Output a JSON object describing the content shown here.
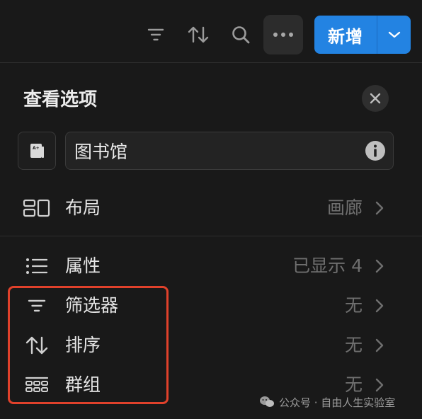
{
  "toolbar": {
    "icons": [
      "filter-icon",
      "sort-icon",
      "search-icon",
      "more-icon"
    ],
    "new_button_label": "新增",
    "new_button_dropdown_icon": "chevron-down-icon",
    "accent_color": "#2383e2"
  },
  "panel": {
    "title": "查看选项",
    "close_icon": "close-icon",
    "database": {
      "icon": "book-icon",
      "name": "图书馆",
      "info_icon": "info-icon"
    },
    "layout": {
      "label": "布局",
      "value": "画廊",
      "icon": "layout-icon"
    },
    "properties": {
      "label": "属性",
      "value": "已显示 4",
      "icon": "list-icon"
    },
    "filter": {
      "label": "筛选器",
      "value": "无",
      "icon": "filter-icon"
    },
    "sort": {
      "label": "排序",
      "value": "无",
      "icon": "sort-icon"
    },
    "group": {
      "label": "群组",
      "value": "无",
      "icon": "group-icon"
    }
  },
  "annotation": {
    "highlight_color": "#e0412b"
  },
  "watermark": {
    "text": "公众号 · 自由人生实验室"
  }
}
